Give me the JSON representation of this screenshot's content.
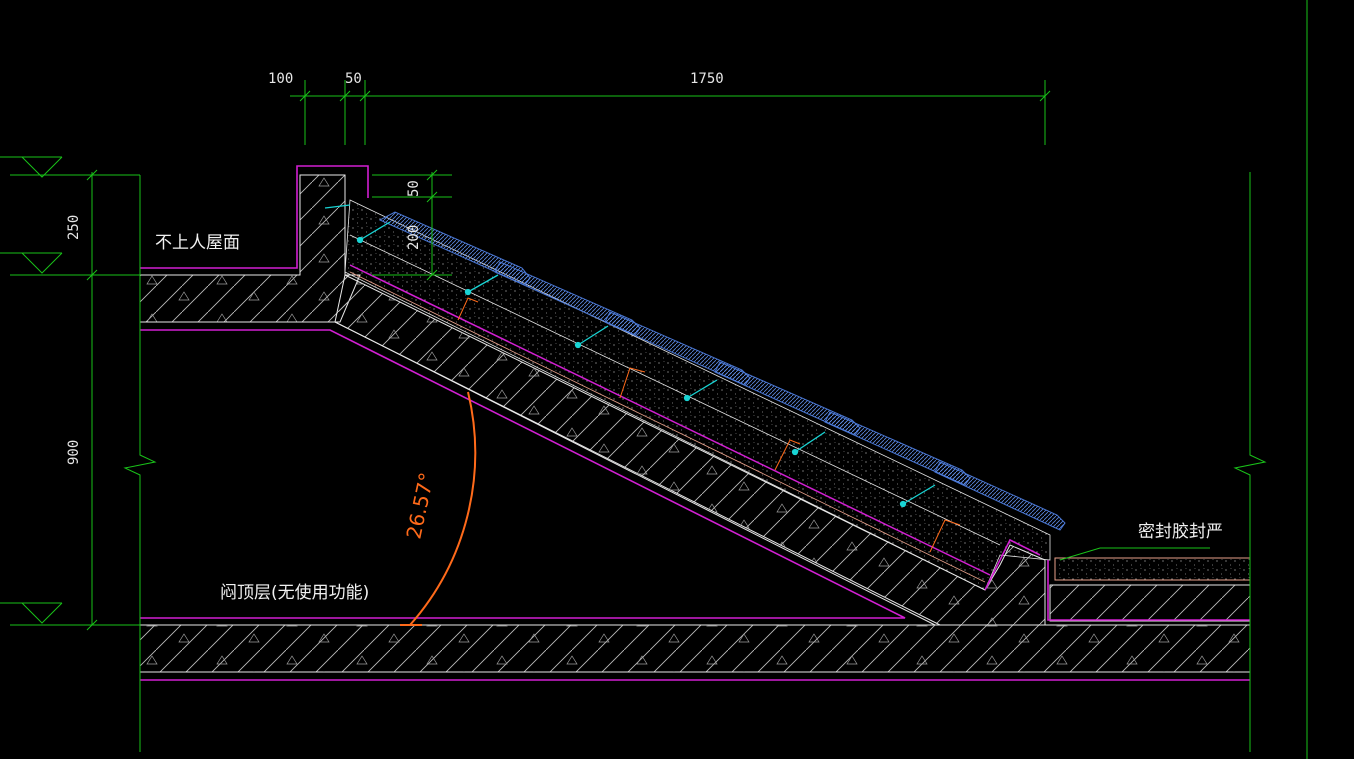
{
  "drawing": {
    "dimensions_top": [
      "100",
      "50",
      "1750"
    ],
    "dimensions_left": [
      "250",
      "900"
    ],
    "dimensions_vertical": [
      "50",
      "200"
    ],
    "angle_label": "26.57°",
    "labels": {
      "upper_roof": "不上人屋面",
      "attic_floor": "闷顶层(无使用功能)",
      "sealant": "密封胶封严"
    }
  },
  "colors": {
    "background": "#000000",
    "dimension_green": "#19c219",
    "outline_white": "#e8e8e8",
    "membrane_magenta": "#d21fd2",
    "tile_blue": "#4a78d6",
    "angle_orange": "#ff6a1a",
    "hook_cyan": "#19d4d4",
    "salmon": "#e8a08a"
  }
}
